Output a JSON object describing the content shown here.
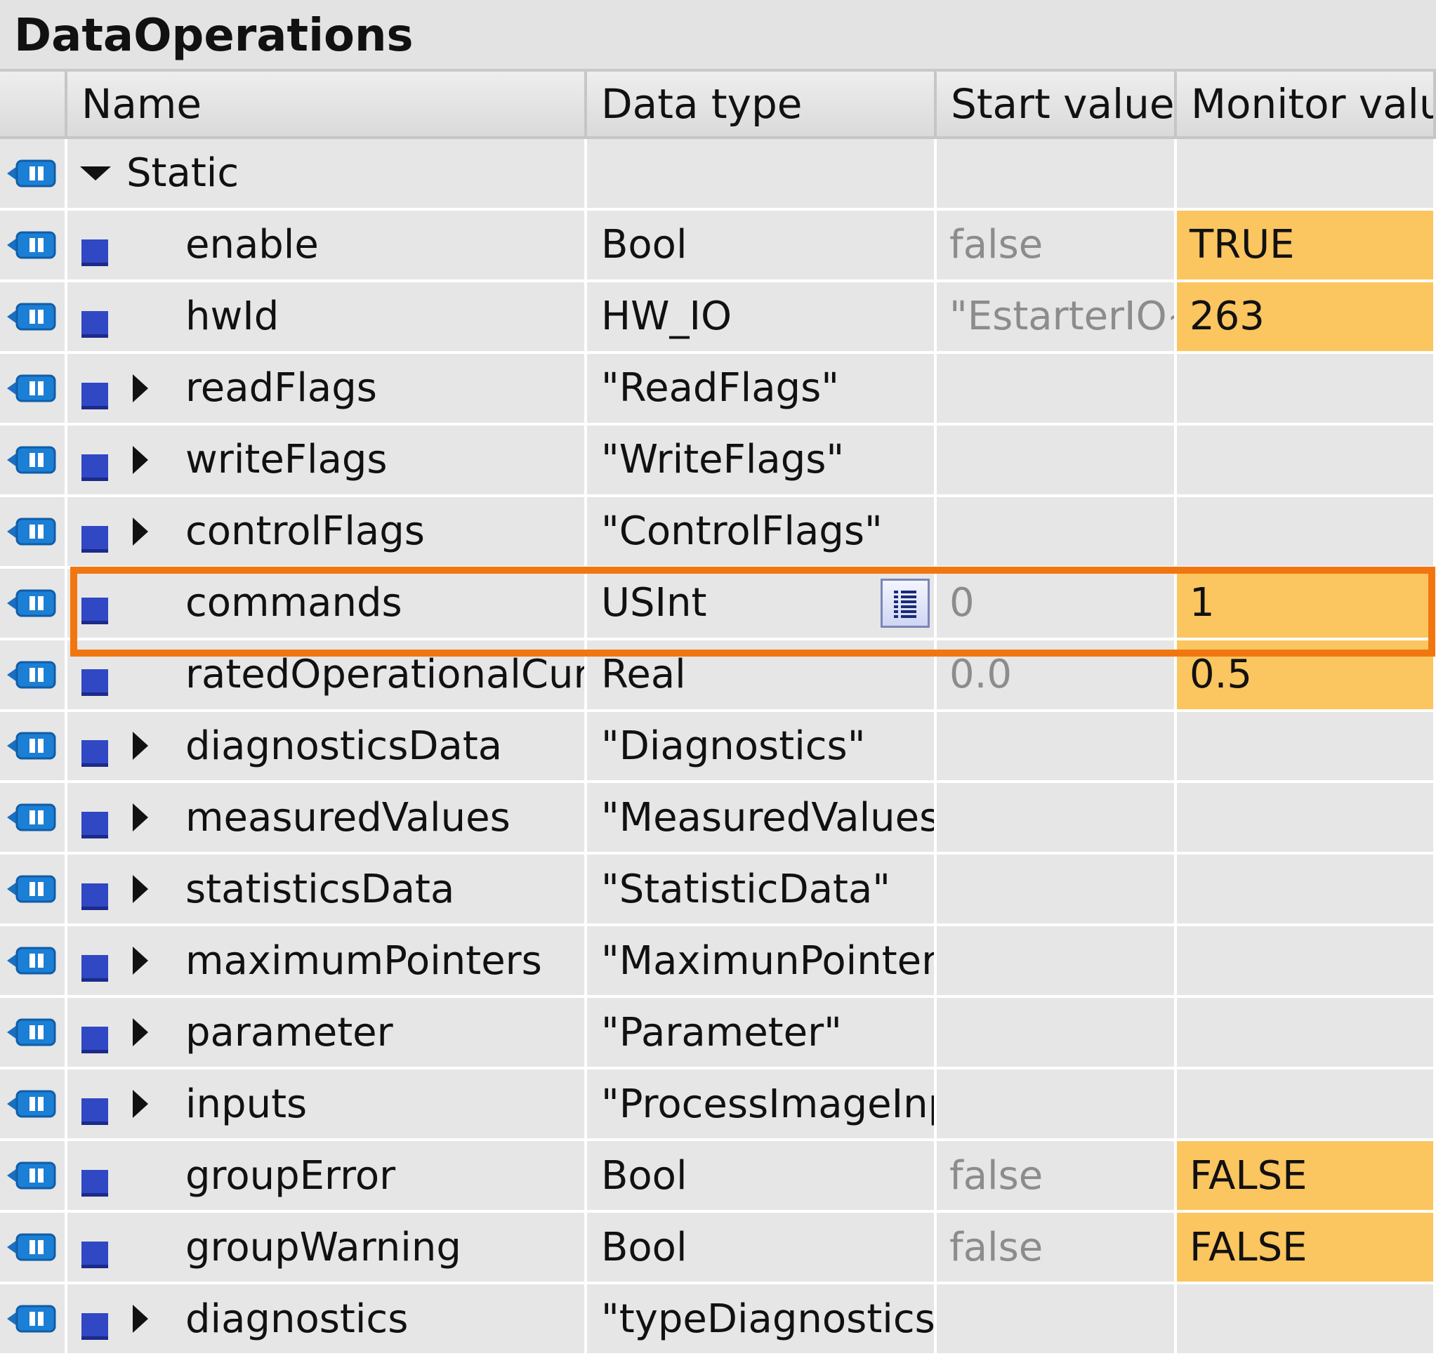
{
  "window": {
    "title": "DataOperations"
  },
  "table": {
    "headers": [
      "",
      "Name",
      "Data type",
      "Start value",
      "Monitor value"
    ],
    "rows": [
      {
        "name": "Static",
        "type": "",
        "start": "",
        "monitor": "",
        "expander": "expanded",
        "section": true
      },
      {
        "name": "enable",
        "type": "Bool",
        "start": "false",
        "monitor": "TRUE",
        "expander": "none"
      },
      {
        "name": "hwId",
        "type": "HW_IO",
        "start": "\"EstarterIO~...",
        "monitor": "263",
        "expander": "none"
      },
      {
        "name": "readFlags",
        "type": "\"ReadFlags\"",
        "start": "",
        "monitor": "",
        "expander": "collapsed"
      },
      {
        "name": "writeFlags",
        "type": "\"WriteFlags\"",
        "start": "",
        "monitor": "",
        "expander": "collapsed"
      },
      {
        "name": "controlFlags",
        "type": "\"ControlFlags\"",
        "start": "",
        "monitor": "",
        "expander": "collapsed"
      },
      {
        "name": "commands",
        "type": "USInt",
        "start": "0",
        "monitor": "1",
        "expander": "none",
        "selected": true,
        "list_button": true
      },
      {
        "name": "ratedOperationalCurr...",
        "type": "Real",
        "start": "0.0",
        "monitor": "0.5",
        "expander": "none"
      },
      {
        "name": "diagnosticsData",
        "type": "\"Diagnostics\"",
        "start": "",
        "monitor": "",
        "expander": "collapsed"
      },
      {
        "name": "measuredValues",
        "type": "\"MeasuredValues\"",
        "start": "",
        "monitor": "",
        "expander": "collapsed"
      },
      {
        "name": "statisticsData",
        "type": "\"StatisticData\"",
        "start": "",
        "monitor": "",
        "expander": "collapsed"
      },
      {
        "name": "maximumPointers",
        "type": "\"MaximunPointer\"",
        "start": "",
        "monitor": "",
        "expander": "collapsed"
      },
      {
        "name": "parameter",
        "type": "\"Parameter\"",
        "start": "",
        "monitor": "",
        "expander": "collapsed"
      },
      {
        "name": "inputs",
        "type": "\"ProcessImageInp...",
        "start": "",
        "monitor": "",
        "expander": "collapsed"
      },
      {
        "name": "groupError",
        "type": "Bool",
        "start": "false",
        "monitor": "FALSE",
        "expander": "none"
      },
      {
        "name": "groupWarning",
        "type": "Bool",
        "start": "false",
        "monitor": "FALSE",
        "expander": "none"
      },
      {
        "name": "diagnostics",
        "type": "\"typeDiagnostics\"",
        "start": "",
        "monitor": "",
        "expander": "collapsed"
      }
    ]
  },
  "colors": {
    "monitor_highlight": "#fbc55f",
    "selection_border": "#f2760f",
    "member_square": "#3048c4",
    "interface_icon": "#1c7fd6"
  },
  "icons": {
    "row_interface": "static-interface-icon",
    "member": "member-square-icon",
    "expand": "triangle-icon",
    "list": "list-button-icon"
  }
}
